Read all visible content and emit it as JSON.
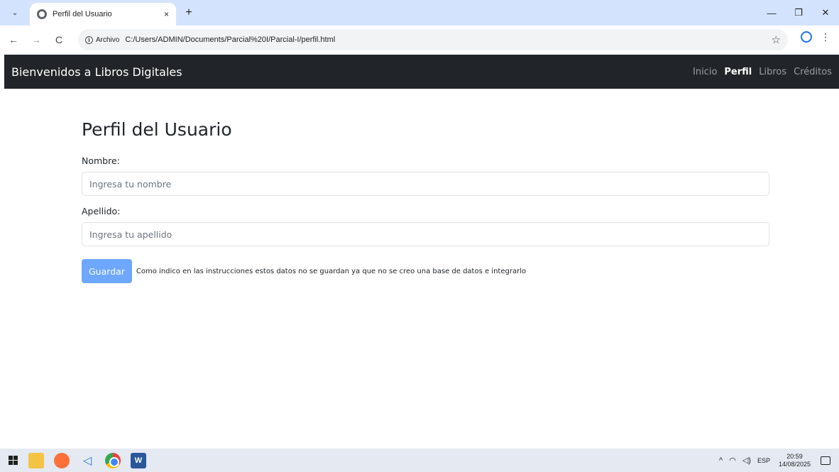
{
  "browser": {
    "tab_title": "Perfil del Usuario",
    "tab_close": "×",
    "new_tab": "+",
    "dropdown": "⌄",
    "minimize": "—",
    "restore": "❐",
    "close": "✕",
    "back": "←",
    "forward": "→",
    "reload": "C",
    "security_label": "Archivo",
    "url": "C:/Users/ADMIN/Documents/Parcial%20I/Parcial-I/perfil.html",
    "star": "☆",
    "menu": "⋮"
  },
  "navbar": {
    "brand": "Bienvenidos a Libros Digitales",
    "links": [
      {
        "label": "Inicio",
        "active": false
      },
      {
        "label": "Perfil",
        "active": true
      },
      {
        "label": "Libros",
        "active": false
      },
      {
        "label": "Créditos",
        "active": false
      }
    ]
  },
  "form": {
    "title": "Perfil del Usuario",
    "nombre_label": "Nombre:",
    "nombre_placeholder": "Ingresa tu nombre",
    "apellido_label": "Apellido:",
    "apellido_placeholder": "Ingresa tu apellido",
    "save_label": "Guardar",
    "note": "Como indico en las instrucciones estos datos no se guardan ya que no se creo una base de datos e integrarlo"
  },
  "taskbar": {
    "icons": [
      "start-icon",
      "file-explorer-icon",
      "firefox-icon",
      "vscode-icon",
      "chrome-icon",
      "word-icon"
    ],
    "word_glyph": "W",
    "vscode_glyph": "◁",
    "tray_up": "^",
    "tray_glyphs": {
      "wifi": "◠",
      "volume": "◁)"
    },
    "language": "ESP",
    "time": "20:59",
    "date": "14/08/2025"
  },
  "colors": {
    "navbar_bg": "#212529",
    "button_bg": "#6ea8fe",
    "tabstrip_bg": "#d3e3fd"
  }
}
